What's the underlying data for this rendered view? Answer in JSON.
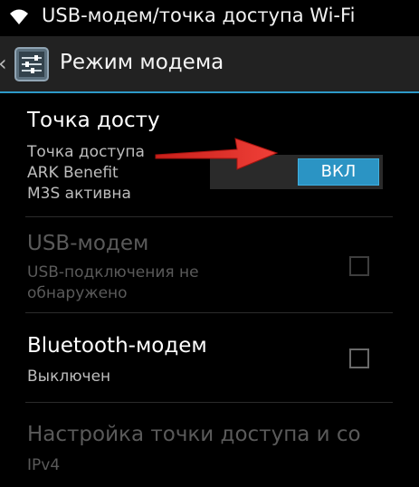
{
  "statusbar": {
    "title": "USB-модем/точка доступа Wi-Fi"
  },
  "actionbar": {
    "back": "‹",
    "title": "Режим модема"
  },
  "items": [
    {
      "title": "Точка досту",
      "subtitle": [
        "Точка доступа",
        "ARK Benefit",
        "M3S активна"
      ],
      "toggle_label": "ВКЛ",
      "toggle_state": "on"
    },
    {
      "title": "USB-модем",
      "subtitle": [
        "USB-подключения не",
        "обнаружено"
      ],
      "enabled": false,
      "checked": false
    },
    {
      "title": "Bluetooth-модем",
      "subtitle": [
        "Выключен"
      ],
      "checked": false
    },
    {
      "title": "Настройка точки доступа и со",
      "subtitle": [
        "IPv4"
      ],
      "enabled": false
    }
  ],
  "colors": {
    "accent": "#2b94c4",
    "arrow": "#e8322c"
  },
  "icons": [
    "wifi-icon",
    "back-icon",
    "settings-sliders-icon",
    "checkbox-icon",
    "arrow-annotation"
  ]
}
